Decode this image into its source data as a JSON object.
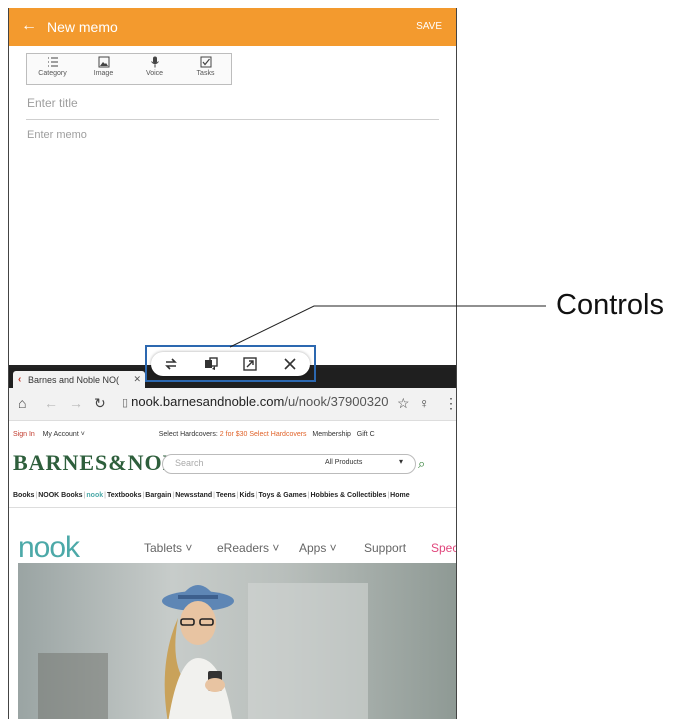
{
  "memo": {
    "title": "New memo",
    "save_label": "SAVE",
    "tools": [
      {
        "label": "Category",
        "icon": "list-icon"
      },
      {
        "label": "Image",
        "icon": "image-icon"
      },
      {
        "label": "Voice",
        "icon": "microphone-icon"
      },
      {
        "label": "Tasks",
        "icon": "checkbox-icon"
      }
    ],
    "title_placeholder": "Enter title",
    "body_placeholder": "Enter memo"
  },
  "browser": {
    "tab_title": "Barnes and Noble NO(",
    "url_host": "nook.barnesandnoble.com",
    "url_path": "/u/nook/37900320",
    "page": {
      "sign_in": "Sign In",
      "my_account": "My Account ˅",
      "promo_prefix": "Select Hardcovers: ",
      "promo_highlight": "2 for $30 Select Hardcovers",
      "membership": "Membership",
      "gift": "Gift C",
      "logo": "BARNES&NOBLE",
      "search_placeholder": "Search",
      "search_category": "All Products",
      "categories": [
        "Books",
        "NOOK Books",
        "nook",
        "Textbooks",
        "Bargain",
        "Newsstand",
        "Teens",
        "Kids",
        "Toys & Games",
        "Hobbies & Collectibles",
        "Home"
      ],
      "nook_logo": "nook",
      "nav": [
        "Tablets ˅",
        "eReaders ˅",
        "Apps ˅",
        "Support",
        "Speci"
      ]
    }
  },
  "callout": {
    "label": "Controls"
  },
  "colors": {
    "memo_bar": "#f39a2e",
    "controls_highlight": "#2c68b0",
    "bn_green": "#2e5f3c",
    "nook_teal": "#4ca9a8"
  }
}
